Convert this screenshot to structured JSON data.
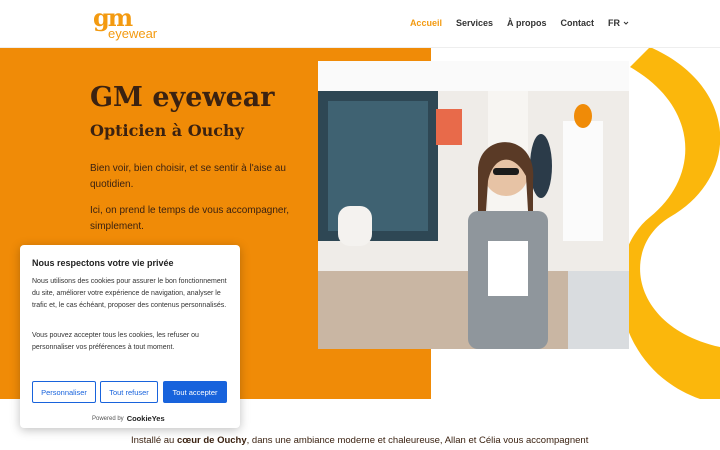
{
  "header": {
    "logo_top": "gm",
    "logo_bottom": "eyewear",
    "nav": [
      "Accueil",
      "Services",
      "À propos",
      "Contact"
    ],
    "lang": "FR"
  },
  "hero": {
    "title": "GM eyewear",
    "subtitle": "Opticien à Ouchy",
    "p1": "Bien voir, bien choisir, et se sentir à l'aise au quotidien.",
    "p2": "Ici, on prend le temps de vous accompagner, simplement."
  },
  "cookie": {
    "title": "Nous respectons votre vie privée",
    "p1": "Nous utilisons des cookies pour assurer le bon fonctionnement du site, améliorer votre expérience de navigation, analyser le trafic et, le cas échéant, proposer des contenus personnalisés.",
    "p2": "Vous pouvez accepter tous les cookies, les refuser ou personnaliser vos préférences à tout moment.",
    "btn_customize": "Personnaliser",
    "btn_refuse": "Tout refuser",
    "btn_accept": "Tout accepter",
    "powered_by": "Powered by",
    "brand": "CookieYes"
  },
  "bottom": {
    "prefix": "Installé au ",
    "bold": "cœur de Ouchy",
    "suffix": ", dans une ambiance moderne et chaleureuse, Allan et Célia vous accompagnent"
  },
  "colors": {
    "orange": "#f08b07",
    "yellow": "#fbb70c",
    "accent": "#f39a10",
    "dark_text": "#3b2211",
    "button_blue": "#1863dc"
  }
}
